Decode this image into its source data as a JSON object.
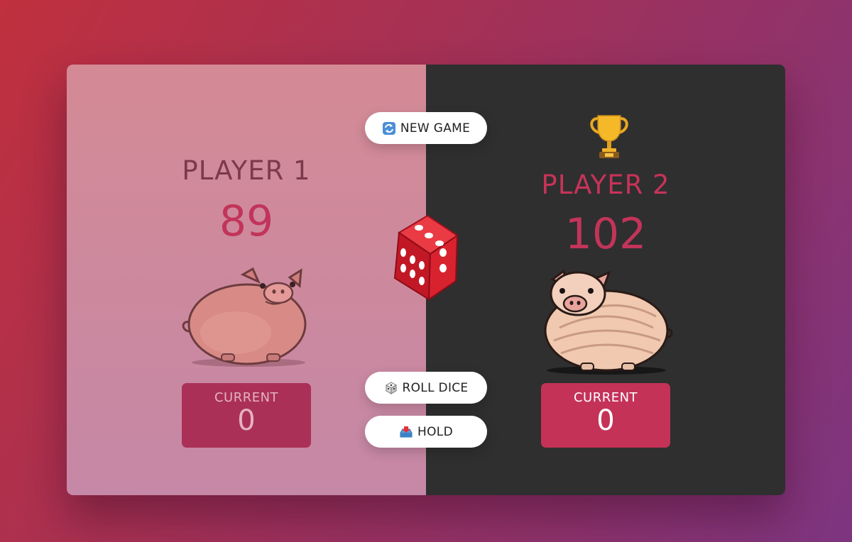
{
  "buttons": {
    "new_game": "NEW GAME",
    "roll_dice": "ROLL DICE",
    "hold": "HOLD"
  },
  "players": [
    {
      "name": "PLAYER 1",
      "score": "89",
      "current_label": "CURRENT",
      "current": "0",
      "active": false
    },
    {
      "name": "PLAYER 2",
      "score": "102",
      "current_label": "CURRENT",
      "current": "0",
      "active": true,
      "winner": true
    }
  ],
  "dice": {
    "face": 5
  },
  "colors": {
    "accent": "#c43258",
    "player1_bg": "#d48a95",
    "player2_bg": "#2f2f2f"
  }
}
